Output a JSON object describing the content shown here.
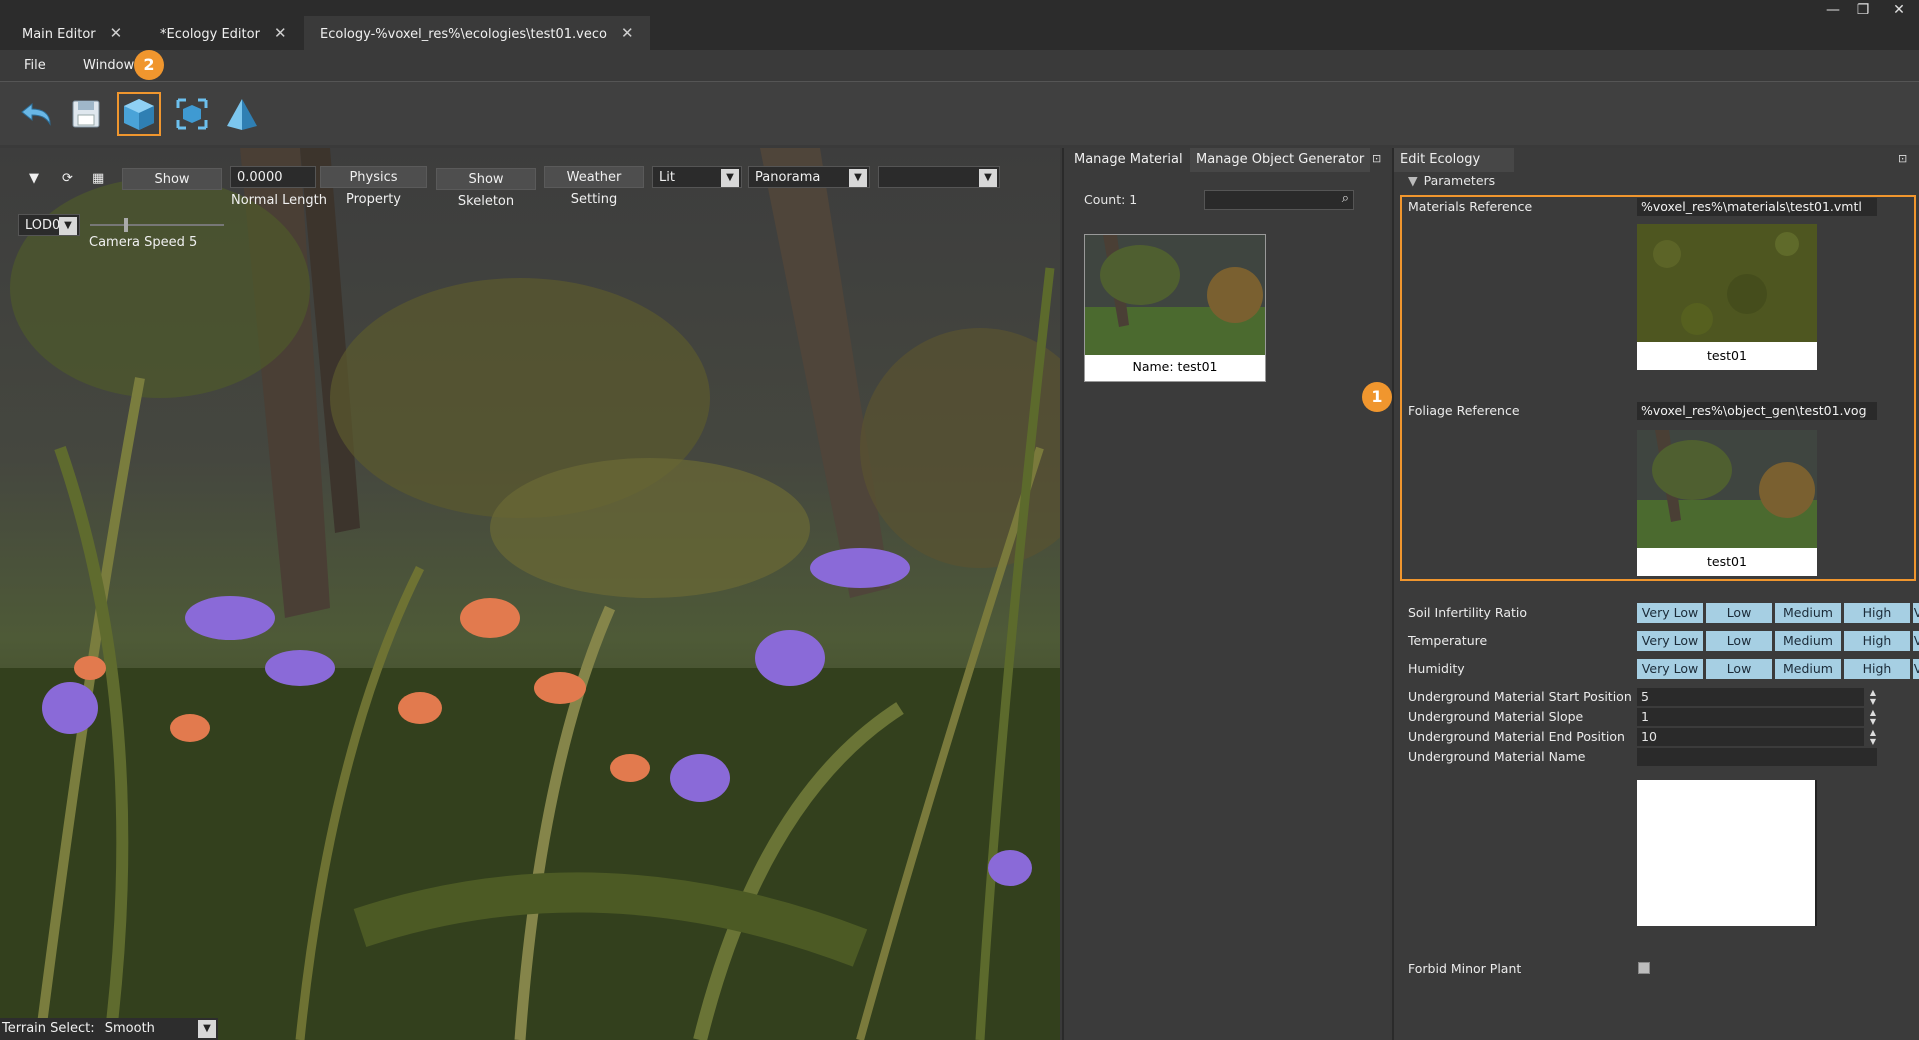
{
  "tabs": [
    {
      "label": "Main Editor"
    },
    {
      "label": "*Ecology Editor"
    },
    {
      "label": "Ecology-%voxel_res%\\ecologies\\test01.veco"
    }
  ],
  "window_controls": {
    "minimize": "—",
    "restore": "❐",
    "close": "✕"
  },
  "menu": {
    "file": "File",
    "window": "Window"
  },
  "badges": {
    "one": "1",
    "two": "2"
  },
  "toolbar": {
    "icons": [
      "undo-icon",
      "save-icon",
      "cube-icon",
      "frame-icon",
      "pyramid-icon"
    ]
  },
  "viewport": {
    "show_label": "Show",
    "normal_length_value": "0.0000",
    "normal_length_label": "Normal Length",
    "physics_property": "Physics Property",
    "show_skeleton": "Show Skeleton",
    "weather_setting": "Weather Setting",
    "lit_value": "Lit",
    "panorama_value": "Panorama",
    "extra_value": "",
    "lod_value": "LOD0",
    "camera_speed": "Camera Speed 5",
    "terrain_select_label": "Terrain Select:",
    "terrain_select_value": "Smooth"
  },
  "material_panel": {
    "tab_manage_material": "Manage Material",
    "tab_manage_object_generator": "Manage Object Generator",
    "count": "Count: 1",
    "search_placeholder": "",
    "item_name": "Name: test01"
  },
  "eco_panel": {
    "title": "Edit Ecology",
    "section": "Parameters",
    "materials_reference_label": "Materials Reference",
    "materials_reference_value": "%voxel_res%\\materials\\test01.vmtl",
    "materials_thumb_caption": "test01",
    "foliage_reference_label": "Foliage Reference",
    "foliage_reference_value": "%voxel_res%\\object_gen\\test01.vog",
    "foliage_thumb_caption": "test01",
    "level_rows": [
      {
        "label": "Soil Infertility Ratio",
        "levels": [
          "Very Low",
          "Low",
          "Medium",
          "High",
          "V"
        ]
      },
      {
        "label": "Temperature",
        "levels": [
          "Very Low",
          "Low",
          "Medium",
          "High",
          "V"
        ]
      },
      {
        "label": "Humidity",
        "levels": [
          "Very Low",
          "Low",
          "Medium",
          "High",
          "V"
        ]
      }
    ],
    "numeric_rows": [
      {
        "label": "Underground Material Start Position",
        "value": "5"
      },
      {
        "label": "Underground Material Slope",
        "value": "1"
      },
      {
        "label": "Underground Material End Position",
        "value": "10"
      }
    ],
    "underground_material_name_label": "Underground Material Name",
    "underground_material_name_value": "",
    "forbid_minor_plant_label": "Forbid Minor Plant"
  },
  "colors": {
    "accent": "#f0962e",
    "level_button": "#a6cfe3"
  }
}
